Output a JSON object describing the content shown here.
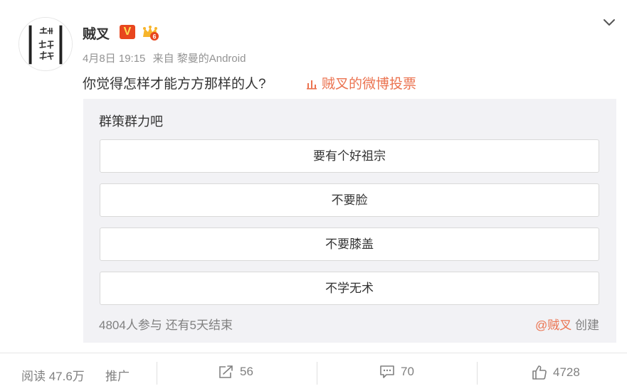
{
  "post": {
    "username": "贼叉",
    "verified_badge": "V",
    "avatar_icon": "calligraphy-avatar",
    "date": "4月8日 19:15",
    "source": "来自 黎曼的Android",
    "text": "你觉得怎样才能方方那样的人?",
    "vote_link": "贼叉的微博投票"
  },
  "poll": {
    "title": "群策群力吧",
    "options": [
      "要有个好祖宗",
      "不要脸",
      "不要膝盖",
      "不学无术"
    ],
    "participants": "4804人参与",
    "remaining": "还有5天结束",
    "creator": "@贼叉",
    "created_label": "创建"
  },
  "stats": {
    "read": "阅读 47.6万",
    "promote": "推广",
    "reposts": "56",
    "comments": "70",
    "likes": "4728"
  },
  "colors": {
    "accent": "#eb7350",
    "verified": "#e8461e",
    "poll_bg": "#f2f2f5"
  }
}
